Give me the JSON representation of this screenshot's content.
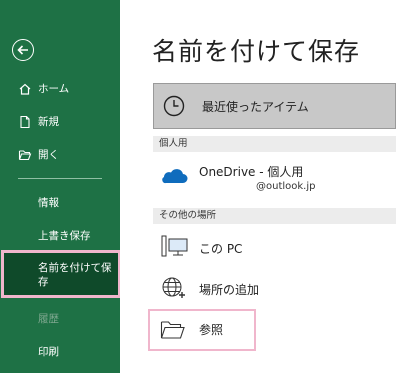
{
  "sidebar": {
    "back_label": "",
    "items": [
      {
        "label": "ホーム",
        "icon": "home-icon"
      },
      {
        "label": "新規",
        "icon": "new-document-icon"
      },
      {
        "label": "開く",
        "icon": "open-folder-icon"
      },
      {
        "label": "情報"
      },
      {
        "label": "上書き保存"
      },
      {
        "label": "名前を付けて保存"
      },
      {
        "label": "履歴"
      },
      {
        "label": "印刷"
      }
    ]
  },
  "main": {
    "title": "名前を付けて保存",
    "recent_label": "最近使ったアイテム",
    "sections": [
      {
        "header": "個人用"
      },
      {
        "header": "その他の場所"
      }
    ],
    "locations": [
      {
        "label": "OneDrive - 個人用",
        "sub": "@outlook.jp",
        "icon": "onedrive-cloud-icon"
      },
      {
        "label": "この PC",
        "icon": "computer-icon"
      },
      {
        "label": "場所の追加",
        "icon": "globe-add-icon"
      },
      {
        "label": "参照",
        "icon": "folder-icon"
      }
    ]
  },
  "colors": {
    "sidebar": "#1e7145",
    "selected": "#0f4a2a",
    "highlight": "#f0b6cc",
    "onedrive": "#0f6cbd"
  }
}
